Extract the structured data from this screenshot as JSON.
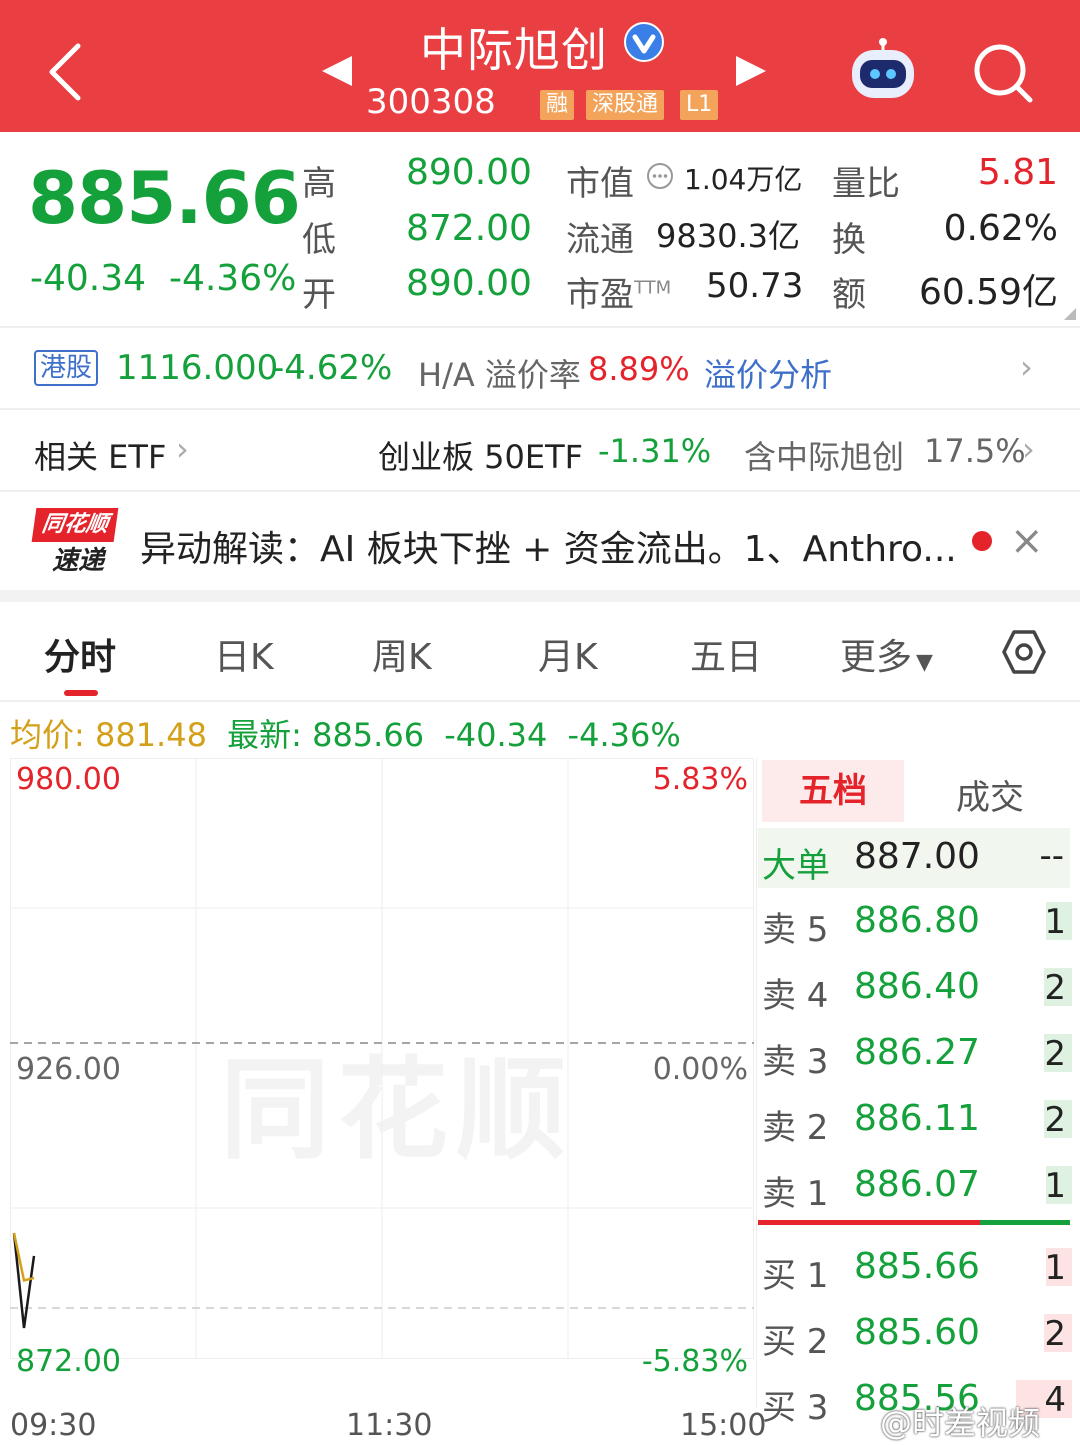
{
  "header": {
    "title": "中际旭创",
    "code": "300308",
    "tags": [
      "融",
      "深股通",
      "L1"
    ],
    "bg_color": "#ea3f42"
  },
  "quote": {
    "price": "885.66",
    "change": "-40.34",
    "change_pct": "-4.36%",
    "fields": [
      {
        "label": "高",
        "value": "890.00"
      },
      {
        "label": "低",
        "value": "872.00"
      },
      {
        "label": "开",
        "value": "890.00"
      },
      {
        "label": "市值",
        "value": "1.04万亿"
      },
      {
        "label": "流通",
        "value": "9830.3亿"
      },
      {
        "label": "市盈",
        "sup": "TTM",
        "value": "50.73"
      },
      {
        "label": "量比",
        "value": "5.81"
      },
      {
        "label": "换",
        "value": "0.62%"
      },
      {
        "label": "额",
        "value": "60.59亿"
      }
    ]
  },
  "hk": {
    "badge": "港股",
    "price": "1116.000",
    "change_pct": "-4.62%",
    "premium_label": "H/A 溢价率",
    "premium_value": "8.89%",
    "analysis_link": "溢价分析"
  },
  "etf": {
    "label": "相关 ETF",
    "name": "创业板 50ETF",
    "change_pct": "-1.31%",
    "holding_label": "含中际旭创",
    "holding_pct": "17.5%"
  },
  "news": {
    "logo_top": "同花顺",
    "logo_bottom": "速递",
    "text": "异动解读：AI 板块下挫 + 资金流出。1、Anthro..."
  },
  "tabs": [
    "分时",
    "日K",
    "周K",
    "月K",
    "五日",
    "更多"
  ],
  "info_line": {
    "avg_label": "均价:",
    "avg_value": "881.48",
    "latest_label": "最新:",
    "latest_value": "885.66",
    "change": "-40.34",
    "change_pct": "-4.36%"
  },
  "chart_data": {
    "type": "line",
    "title": "",
    "xlabel": "",
    "ylabel": "",
    "ylim": [
      872.0,
      980.0
    ],
    "y_ticks_left": [
      "980.00",
      "926.00",
      "872.00"
    ],
    "y_ticks_right": [
      "5.83%",
      "0.00%",
      "-5.83%"
    ],
    "x_ticks": [
      "09:30",
      "11:30",
      "15:00"
    ],
    "reference_price": 926.0,
    "series": [
      {
        "values": [
          890.0,
          872.0,
          885.66
        ],
        "color": "#1a1a1a"
      },
      {
        "values": [
          890.0,
          881.0,
          881.48
        ],
        "color": "#d4a01a"
      }
    ],
    "watermark": "同花顺"
  },
  "order_book": {
    "tabs": [
      "五档",
      "成交"
    ],
    "big_order": {
      "label": "大单",
      "price": "887.00",
      "vol": "--"
    },
    "asks": [
      {
        "label": "卖 5",
        "price": "886.80",
        "vol": "1"
      },
      {
        "label": "卖 4",
        "price": "886.40",
        "vol": "2"
      },
      {
        "label": "卖 3",
        "price": "886.27",
        "vol": "2"
      },
      {
        "label": "卖 2",
        "price": "886.11",
        "vol": "2"
      },
      {
        "label": "卖 1",
        "price": "886.07",
        "vol": "1"
      }
    ],
    "bids": [
      {
        "label": "买 1",
        "price": "885.66",
        "vol": "1"
      },
      {
        "label": "买 2",
        "price": "885.60",
        "vol": "2"
      },
      {
        "label": "买 3",
        "price": "885.56",
        "vol": "4"
      }
    ]
  },
  "watermark_text": "@时差视频"
}
